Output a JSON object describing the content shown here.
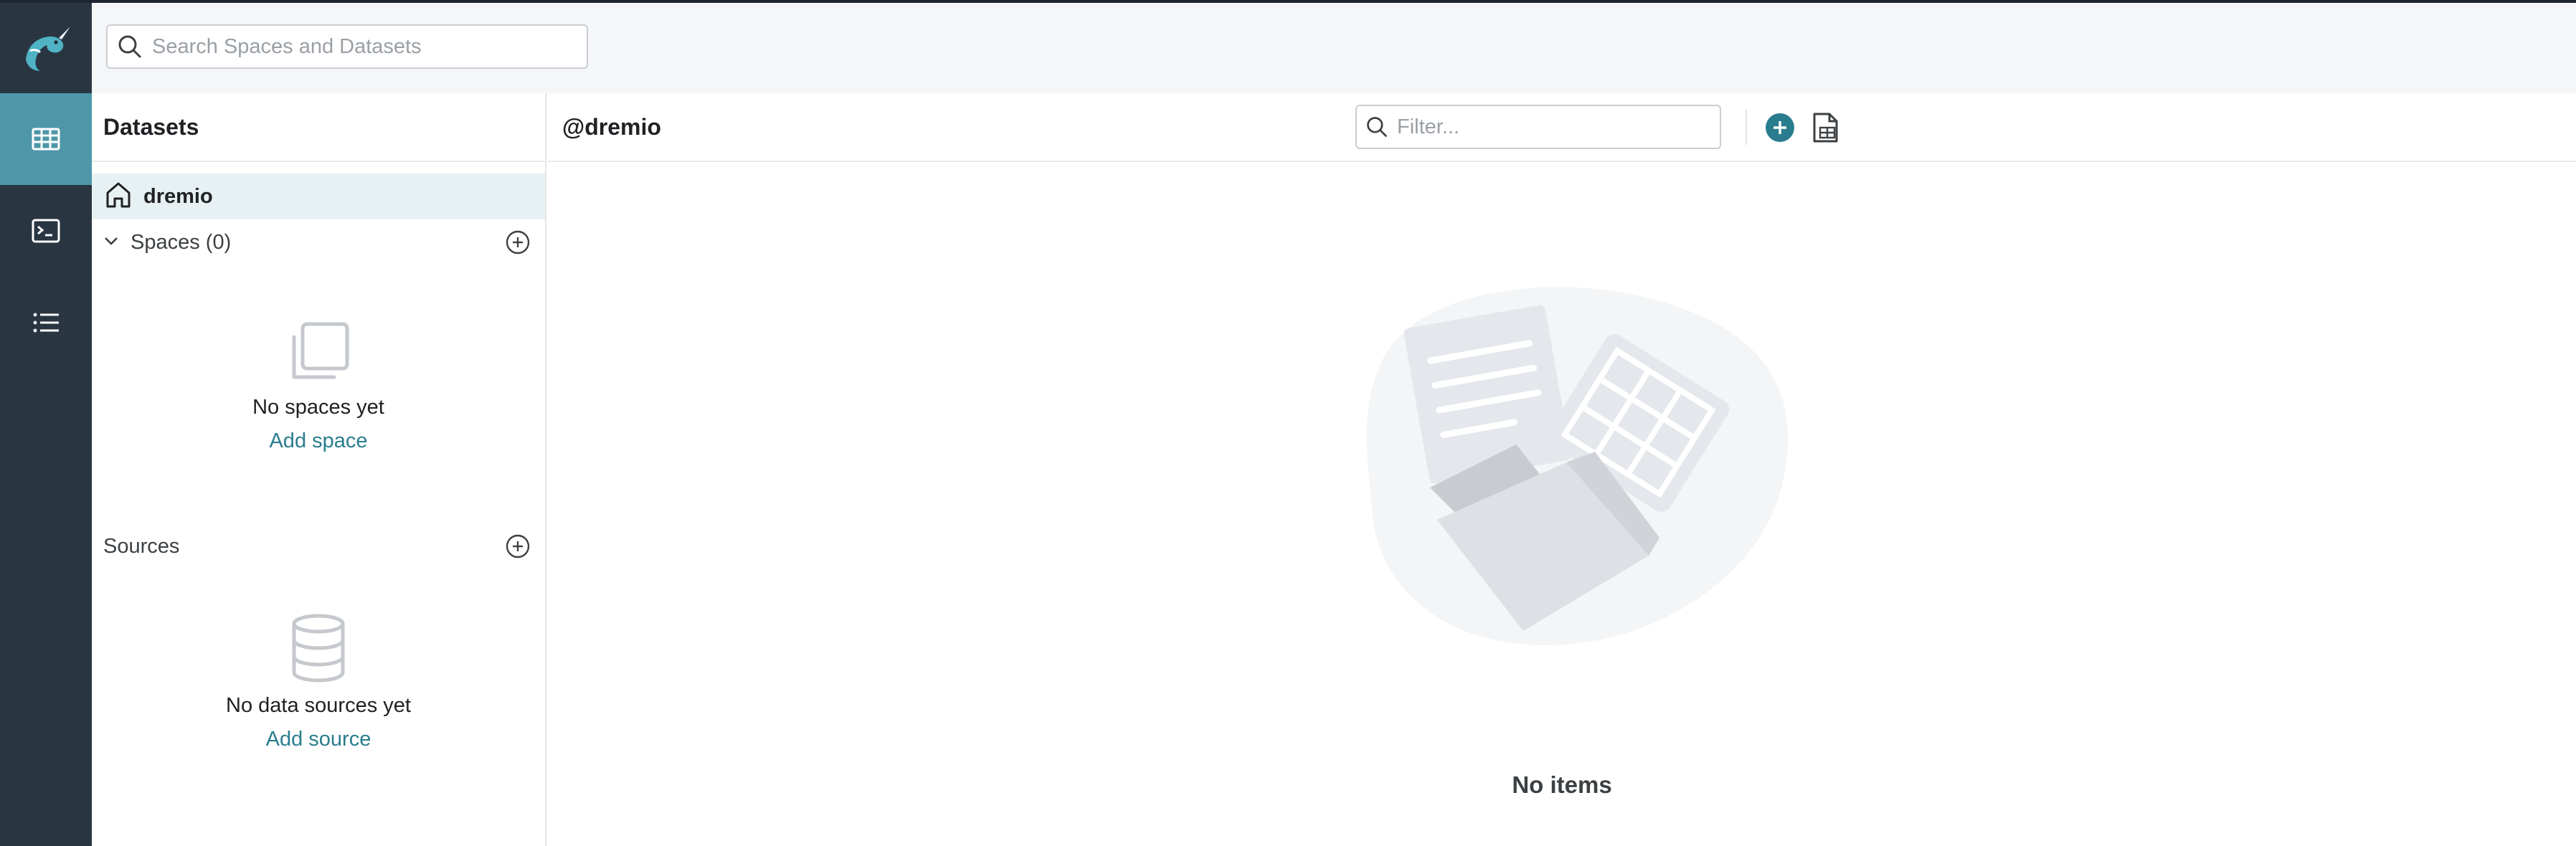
{
  "colors": {
    "rail_bg": "#2a3542",
    "rail_active": "#4e97a8",
    "accent": "#2a7d8e",
    "header_bg": "#f4f6f8",
    "selected_row": "#e7f1f3"
  },
  "nav": {
    "logo_icon": "narwhal-logo-icon",
    "items": [
      {
        "name": "datasets",
        "icon": "table-grid-icon",
        "active": true
      },
      {
        "name": "sql-runner",
        "icon": "terminal-icon",
        "active": false
      },
      {
        "name": "jobs",
        "icon": "list-icon",
        "active": false
      }
    ]
  },
  "search": {
    "placeholder": "Search Spaces and Datasets",
    "value": ""
  },
  "sidebar": {
    "title": "Datasets",
    "home": {
      "label": "dremio",
      "icon": "home-icon"
    },
    "spaces": {
      "label": "Spaces (0)",
      "empty_message": "No spaces yet",
      "add_link": "Add space"
    },
    "sources": {
      "label": "Sources",
      "empty_message": "No data sources yet",
      "add_link": "Add source"
    }
  },
  "main": {
    "title": "@dremio",
    "filter_placeholder": "Filter...",
    "filter_value": "",
    "empty_message": "No items"
  }
}
